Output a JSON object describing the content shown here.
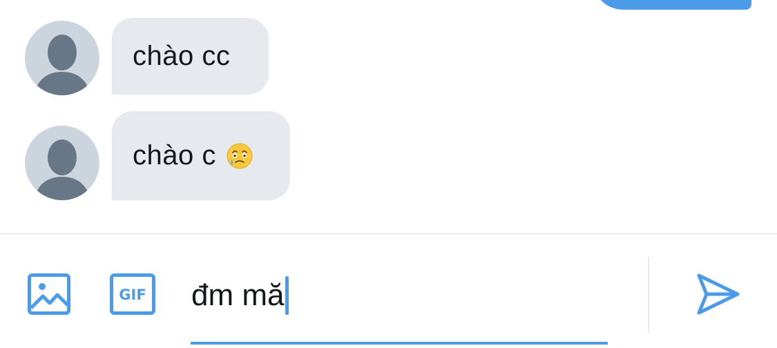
{
  "messages": [
    {
      "text": "chào cc",
      "emoji": ""
    },
    {
      "text": "chào c",
      "emoji": "face-holding-back-tears"
    }
  ],
  "composer": {
    "value": "đm mă",
    "image_icon": "image-icon",
    "gif_label": "GIF",
    "send_icon": "send-icon"
  },
  "colors": {
    "accent": "#4c9be8",
    "bubble": "#e6e9ed",
    "avatar_bg": "#ccd5dd",
    "avatar_fg": "#687787",
    "text": "#14171a",
    "divider": "#dcdfe3"
  }
}
